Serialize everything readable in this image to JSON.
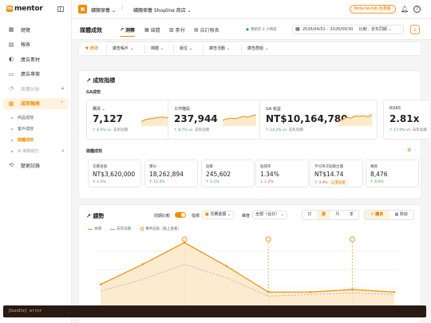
{
  "brand": {
    "logo_letter": "m",
    "name": "mentor"
  },
  "sidebar": {
    "items": [
      {
        "label": "總覽",
        "icon": "grid-icon"
      },
      {
        "label": "報表",
        "icon": "report-icon"
      },
      {
        "label": "廣告素材",
        "icon": "palette-icon"
      },
      {
        "label": "廣告專案",
        "icon": "folder-icon"
      },
      {
        "label": "商償分析",
        "icon": "chart-icon",
        "locked": true
      },
      {
        "label": "成效報表",
        "icon": "trend-icon",
        "active": true
      },
      {
        "label": "變更記錄",
        "icon": "history-icon"
      }
    ],
    "subitems": [
      {
        "label": "商品成效"
      },
      {
        "label": "客戶成效"
      },
      {
        "label": "媒體成效",
        "active": true
      },
      {
        "label": "AI 策略報告",
        "locked": true
      }
    ]
  },
  "topbar": {
    "shop_name": "繡顏保養",
    "store_name": "繡顏保養 Shopline 商店",
    "beta_badge": "Beta-tw-tsb 內測版"
  },
  "subbar": {
    "title": "媒體成效",
    "tabs": [
      {
        "label": "洞察",
        "icon": "insight-icon",
        "active": true
      },
      {
        "label": "媒體",
        "icon": "media-icon"
      },
      {
        "label": "素材",
        "icon": "image-icon"
      },
      {
        "label": "自訂報表",
        "icon": "table-icon"
      }
    ],
    "update_note": "更新於 2 小時前",
    "date_range": "2026/04/01 – 2026/09/30",
    "compare": "比較：去年同期"
  },
  "filters": {
    "first": "篩選",
    "chips": [
      "廣告帳戶",
      "媒體",
      "版位",
      "廣告活動",
      "廣告群組"
    ]
  },
  "metrics": {
    "title": "成效指標",
    "ga_label": "GA成效",
    "kpis": [
      {
        "label": "購買",
        "value": "7,127",
        "change": "6.5%",
        "cmp": "vs. 去年同期",
        "trend": [
          0.3,
          0.45,
          0.5,
          0.55,
          0.6,
          0.62,
          0.58,
          0.7,
          0.75
        ]
      },
      {
        "label": "工作階段",
        "value": "237,944",
        "change": "8.7%",
        "cmp": "vs. 去年同期",
        "trend": [
          0.4,
          0.5,
          0.55,
          0.5,
          0.6,
          0.68,
          0.6,
          0.72,
          0.78
        ]
      },
      {
        "label": "GA 收益",
        "value": "NT$10,164,780",
        "change": "14.2%",
        "cmp": "vs. 去年同期",
        "trend": [
          0.3,
          0.45,
          0.6,
          0.55,
          0.7,
          0.68,
          0.72,
          0.65,
          0.8
        ]
      },
      {
        "label": "ROAS",
        "value": "2.81x",
        "change": "17.0%",
        "cmp": "vs. 去年同期",
        "trend": [
          0.2,
          0.35,
          0.4,
          0.5,
          0.48,
          0.6
        ]
      }
    ],
    "media_label": "媒體成效",
    "smalls": [
      {
        "label": "花費金額",
        "value": "NT$3,620,000",
        "change": "2.3%",
        "dir": "flat"
      },
      {
        "label": "曝光",
        "value": "18,262,894",
        "change": "12.4%",
        "dir": "up"
      },
      {
        "label": "點擊",
        "value": "245,602",
        "change": "5.1%",
        "dir": "up"
      },
      {
        "label": "點閱率",
        "value": "1.34%",
        "change": "1.2%",
        "dir": "down"
      },
      {
        "label": "平均單次點擊出價",
        "value": "NT$14.74",
        "change": "3.4%",
        "dir": "down",
        "tag": "上漲注意"
      },
      {
        "label": "購買",
        "value": "8,476",
        "change": "8.6%",
        "dir": "up"
      }
    ]
  },
  "trend": {
    "title": "趨勢",
    "compare_label": "前期比較",
    "metric_label": "指標",
    "metric_value": "花費金額",
    "dimension_label": "維度",
    "dimension_value": "全部（合計）",
    "granularity": [
      "日",
      "週",
      "月",
      "季"
    ],
    "chart_types": [
      "圖表",
      "數據"
    ],
    "legend": [
      "本期",
      "去年同期",
      "事件記錄（點上查看）"
    ]
  },
  "chart_data": {
    "type": "area",
    "series": [
      {
        "name": "本期",
        "values": [
          130,
          250,
          380,
          240,
          85,
          85,
          100,
          85
        ]
      },
      {
        "name": "去年同期",
        "values": [
          90,
          160,
          250,
          170,
          60,
          70,
          80,
          70
        ]
      }
    ],
    "events_at_index": [
      2,
      4,
      6
    ]
  },
  "error_text": "[bundle] error",
  "colors": {
    "accent": "#f08c00",
    "up": "#2f9e55",
    "down": "#d9453c"
  }
}
